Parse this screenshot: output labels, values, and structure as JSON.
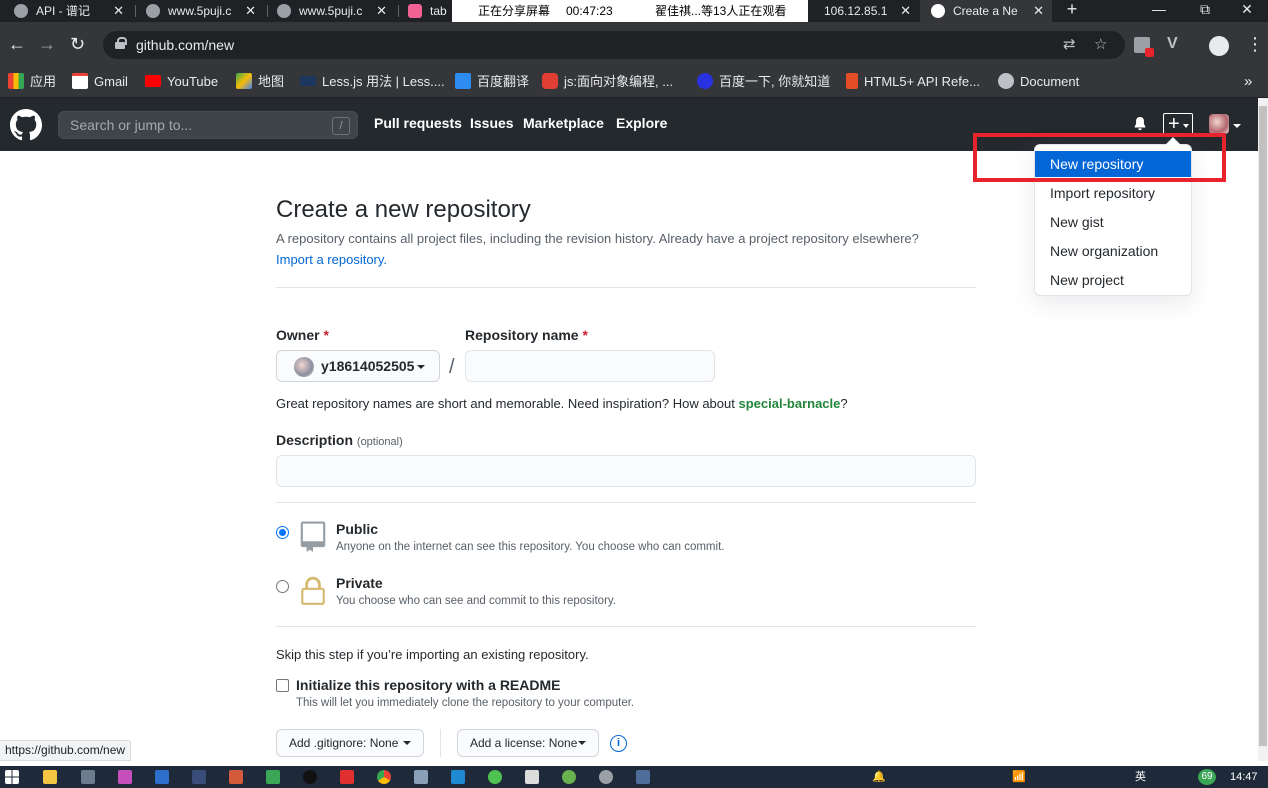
{
  "browser": {
    "tabs": [
      {
        "title": "API - 谱记"
      },
      {
        "title": "www.5puji.c"
      },
      {
        "title": "www.5puji.c"
      },
      {
        "title": "tab"
      },
      {
        "title": "106.12.85.1"
      },
      {
        "title": "Create a Ne"
      }
    ],
    "share_bar": {
      "status": "正在分享屏幕",
      "time": "00:47:23",
      "viewers": "翟佳祺...等13人正在观看"
    },
    "new_tab_label": "+",
    "window_controls": {
      "minimize": "—",
      "maximize": "⧉",
      "close": "✕"
    },
    "url": "github.com/new",
    "bookmarks": [
      {
        "label": "应用",
        "icon": "apps-icon",
        "color": "#ea4335"
      },
      {
        "label": "Gmail",
        "icon": "gmail-icon",
        "color": "#ffffff"
      },
      {
        "label": "YouTube",
        "icon": "youtube-icon",
        "color": "#ff0000"
      },
      {
        "label": "地图",
        "icon": "maps-icon",
        "color": "#34a853"
      },
      {
        "label": "Less.js 用法 | Less....",
        "icon": "less-icon",
        "color": "#1d365d"
      },
      {
        "label": "百度翻译",
        "icon": "translate-icon",
        "color": "#2e8cf0"
      },
      {
        "label": "js:面向对象编程, ...",
        "icon": "csdn-icon",
        "color": "#e33e33"
      },
      {
        "label": "百度一下, 你就知道",
        "icon": "baidu-icon",
        "color": "#2932e1"
      },
      {
        "label": "HTML5+ API Refe...",
        "icon": "html5-icon",
        "color": "#e44d26"
      },
      {
        "label": "Document",
        "icon": "globe-icon",
        "color": "#bdc1c6"
      }
    ],
    "bookmarks_more": "»",
    "status_url": "https://github.com/new"
  },
  "github_header": {
    "search_placeholder": "Search or jump to...",
    "search_shortcut": "/",
    "nav": [
      "Pull requests",
      "Issues",
      "Marketplace",
      "Explore"
    ],
    "plus_label": "+"
  },
  "dropdown": {
    "items": [
      "New repository",
      "Import repository",
      "New gist",
      "New organization",
      "New project"
    ],
    "highlighted": "New repository",
    "highlight_color": "#0366d6",
    "annotation_color": "#e8232d"
  },
  "form": {
    "title": "Create a new repository",
    "subtitle": "A repository contains all project files, including the revision history. Already have a project repository elsewhere?",
    "import_link": "Import a repository.",
    "owner_label": "Owner",
    "required_mark": "*",
    "owner_value": "y18614052505",
    "separator": "/",
    "repo_name_label": "Repository name",
    "repo_name_value": "",
    "hint_prefix": "Great repository names are short and memorable. Need inspiration? How about",
    "hint_suggestion": "special-barnacle",
    "hint_suffix": "?",
    "description_label": "Description",
    "description_optional": "(optional)",
    "description_value": "",
    "visibility": [
      {
        "label": "Public",
        "desc": "Anyone on the internet can see this repository. You choose who can commit.",
        "checked": true
      },
      {
        "label": "Private",
        "desc": "You choose who can see and commit to this repository.",
        "checked": false
      }
    ],
    "skip_text": "Skip this step if you’re importing an existing repository.",
    "readme_label": "Initialize this repository with a README",
    "readme_desc": "This will let you immediately clone the repository to your computer.",
    "readme_checked": false,
    "gitignore_label": "Add .gitignore: None",
    "license_label": "Add a license: None"
  },
  "taskbar": {
    "time": "14:47",
    "ime": "英",
    "badge": "69"
  }
}
